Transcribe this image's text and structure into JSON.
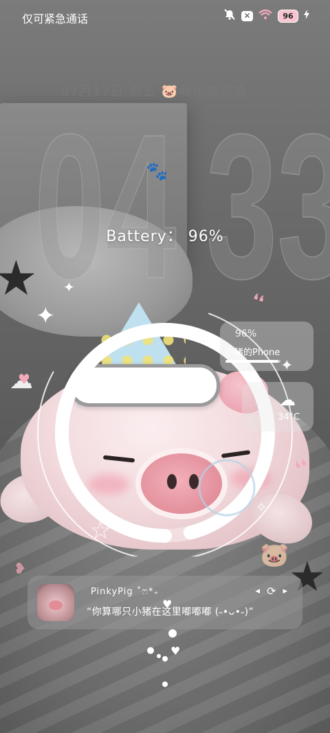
{
  "status_bar": {
    "carrier_text": "仅可紧急通话",
    "icons": [
      "mute-icon",
      "x-icon",
      "wifi-icon",
      "battery-badge-icon",
      "charging-icon"
    ],
    "x_label": "✕",
    "battery_badge": "96"
  },
  "lockscreen": {
    "date_line": "07月17日  周五 🐷萌也是罪嗎☆..",
    "clock": {
      "hour": "04",
      "minute": "33"
    },
    "battery_label": "Battery：",
    "battery_value": "96%",
    "battery_level": 0.96
  },
  "widgets": {
    "device": {
      "percent": "96%",
      "name": "小猪的Phone"
    },
    "weather": {
      "temperature": "34°C"
    }
  },
  "music": {
    "title": "PinkyPig ˚ෆ*₊",
    "lyric": "“你算哪只小猪在这里嘟嘟嘟 (˶•ᴗ•˶)”",
    "prev_label": "◂",
    "mode_label": "⟳",
    "next_label": "▸"
  },
  "colors": {
    "accent_pink": "#f3a9ba",
    "ring": "#ffffff"
  }
}
